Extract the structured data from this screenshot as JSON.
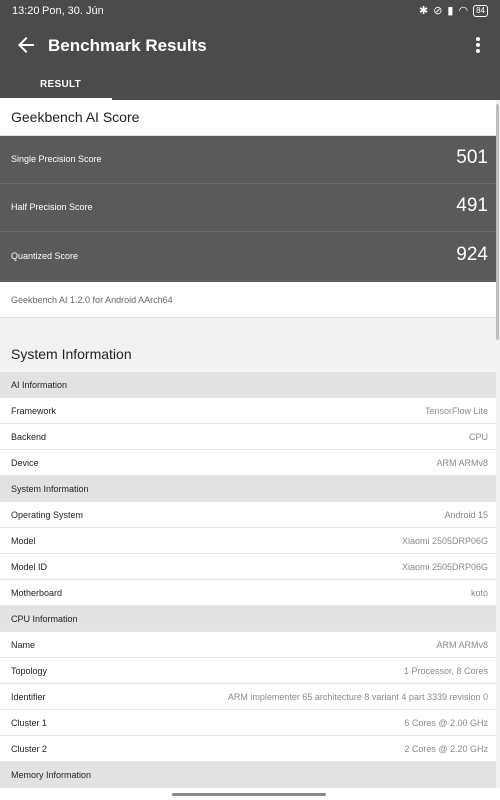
{
  "status_bar": {
    "time": "13:20",
    "date": "Pon, 30. Jún",
    "icons": [
      "bluetooth-icon",
      "mute-icon",
      "signal-icon",
      "wifi-icon"
    ],
    "battery": "84"
  },
  "app_bar": {
    "title": "Benchmark Results",
    "back_icon": "arrow-left-icon",
    "menu_icon": "more-vertical-icon"
  },
  "tabs": [
    {
      "label": "RESULT",
      "selected": true
    }
  ],
  "score_card": {
    "title": "Geekbench AI Score",
    "scores": [
      {
        "label": "Single Precision Score",
        "value": "501"
      },
      {
        "label": "Half Precision Score",
        "value": "491"
      },
      {
        "label": "Quantized Score",
        "value": "924"
      }
    ],
    "footer": "Geekbench AI 1.2.0 for Android AArch64"
  },
  "system_information": {
    "title": "System Information",
    "sections": [
      {
        "header": "AI Information",
        "rows": [
          {
            "key": "Framework",
            "value": "TensorFlow Lite"
          },
          {
            "key": "Backend",
            "value": "CPU"
          },
          {
            "key": "Device",
            "value": "ARM ARMv8"
          }
        ]
      },
      {
        "header": "System Information",
        "rows": [
          {
            "key": "Operating System",
            "value": "Android 15"
          },
          {
            "key": "Model",
            "value": "Xiaomi 2505DRP06G"
          },
          {
            "key": "Model ID",
            "value": "Xiaomi 2505DRP06G"
          },
          {
            "key": "Motherboard",
            "value": "koto"
          }
        ]
      },
      {
        "header": "CPU Information",
        "rows": [
          {
            "key": "Name",
            "value": "ARM ARMv8"
          },
          {
            "key": "Topology",
            "value": "1 Processor, 8 Cores"
          },
          {
            "key": "Identifier",
            "value": "ARM implementer 65 architecture 8 variant 4 part 3339 revision 0"
          },
          {
            "key": "Cluster 1",
            "value": "6 Cores @ 2.00 GHz"
          },
          {
            "key": "Cluster 2",
            "value": "2 Cores @ 2.20 GHz"
          }
        ]
      },
      {
        "header": "Memory Information",
        "rows": []
      }
    ]
  },
  "colors": {
    "app_bar": "#4b4b4b",
    "score_panel": "#5a5a5a",
    "section_header": "#e2e2e2",
    "background": "#f2f2f2"
  }
}
